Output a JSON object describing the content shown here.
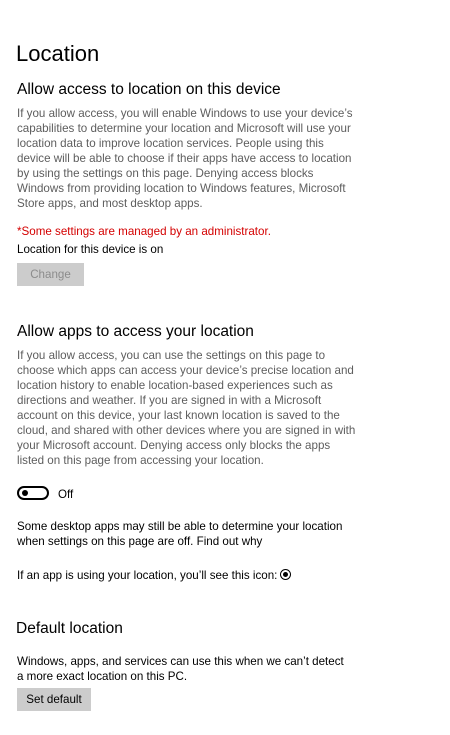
{
  "page": {
    "title": "Location"
  },
  "device_section": {
    "heading": "Allow access to location on this device",
    "description": "If you allow access, you will enable Windows to use your device’s capabilities to determine your location and Microsoft will use your location data to improve location services. People using this device will be able to choose if their apps have access to location by using the settings on this page. Denying access blocks Windows from providing location to Windows features, Microsoft Store apps, and most desktop apps.",
    "admin_note": "*Some settings are managed by an administrator.",
    "status": "Location for this device is on",
    "change_button": "Change"
  },
  "apps_section": {
    "heading": "Allow apps to access your location",
    "description": "If you allow access, you can use the settings on this page to choose which apps can access your device’s precise location and location history to enable location-based experiences such as directions and weather. If you are signed in with a Microsoft account on this device, your last known location is saved to the cloud, and shared with other devices where you are signed in with your Microsoft account. Denying access only blocks the apps listed on this page from accessing your location.",
    "toggle_state": "Off",
    "desktop_note": "Some desktop apps may still be able to determine your location when settings on this page are off.",
    "find_out_link": "Find out why",
    "icon_note": "If an app is using your location, you’ll see this icon:"
  },
  "default_section": {
    "heading": "Default location",
    "description": "Windows, apps, and services can use this when we can’t detect a more exact location on this PC.",
    "set_default_button": "Set default"
  }
}
